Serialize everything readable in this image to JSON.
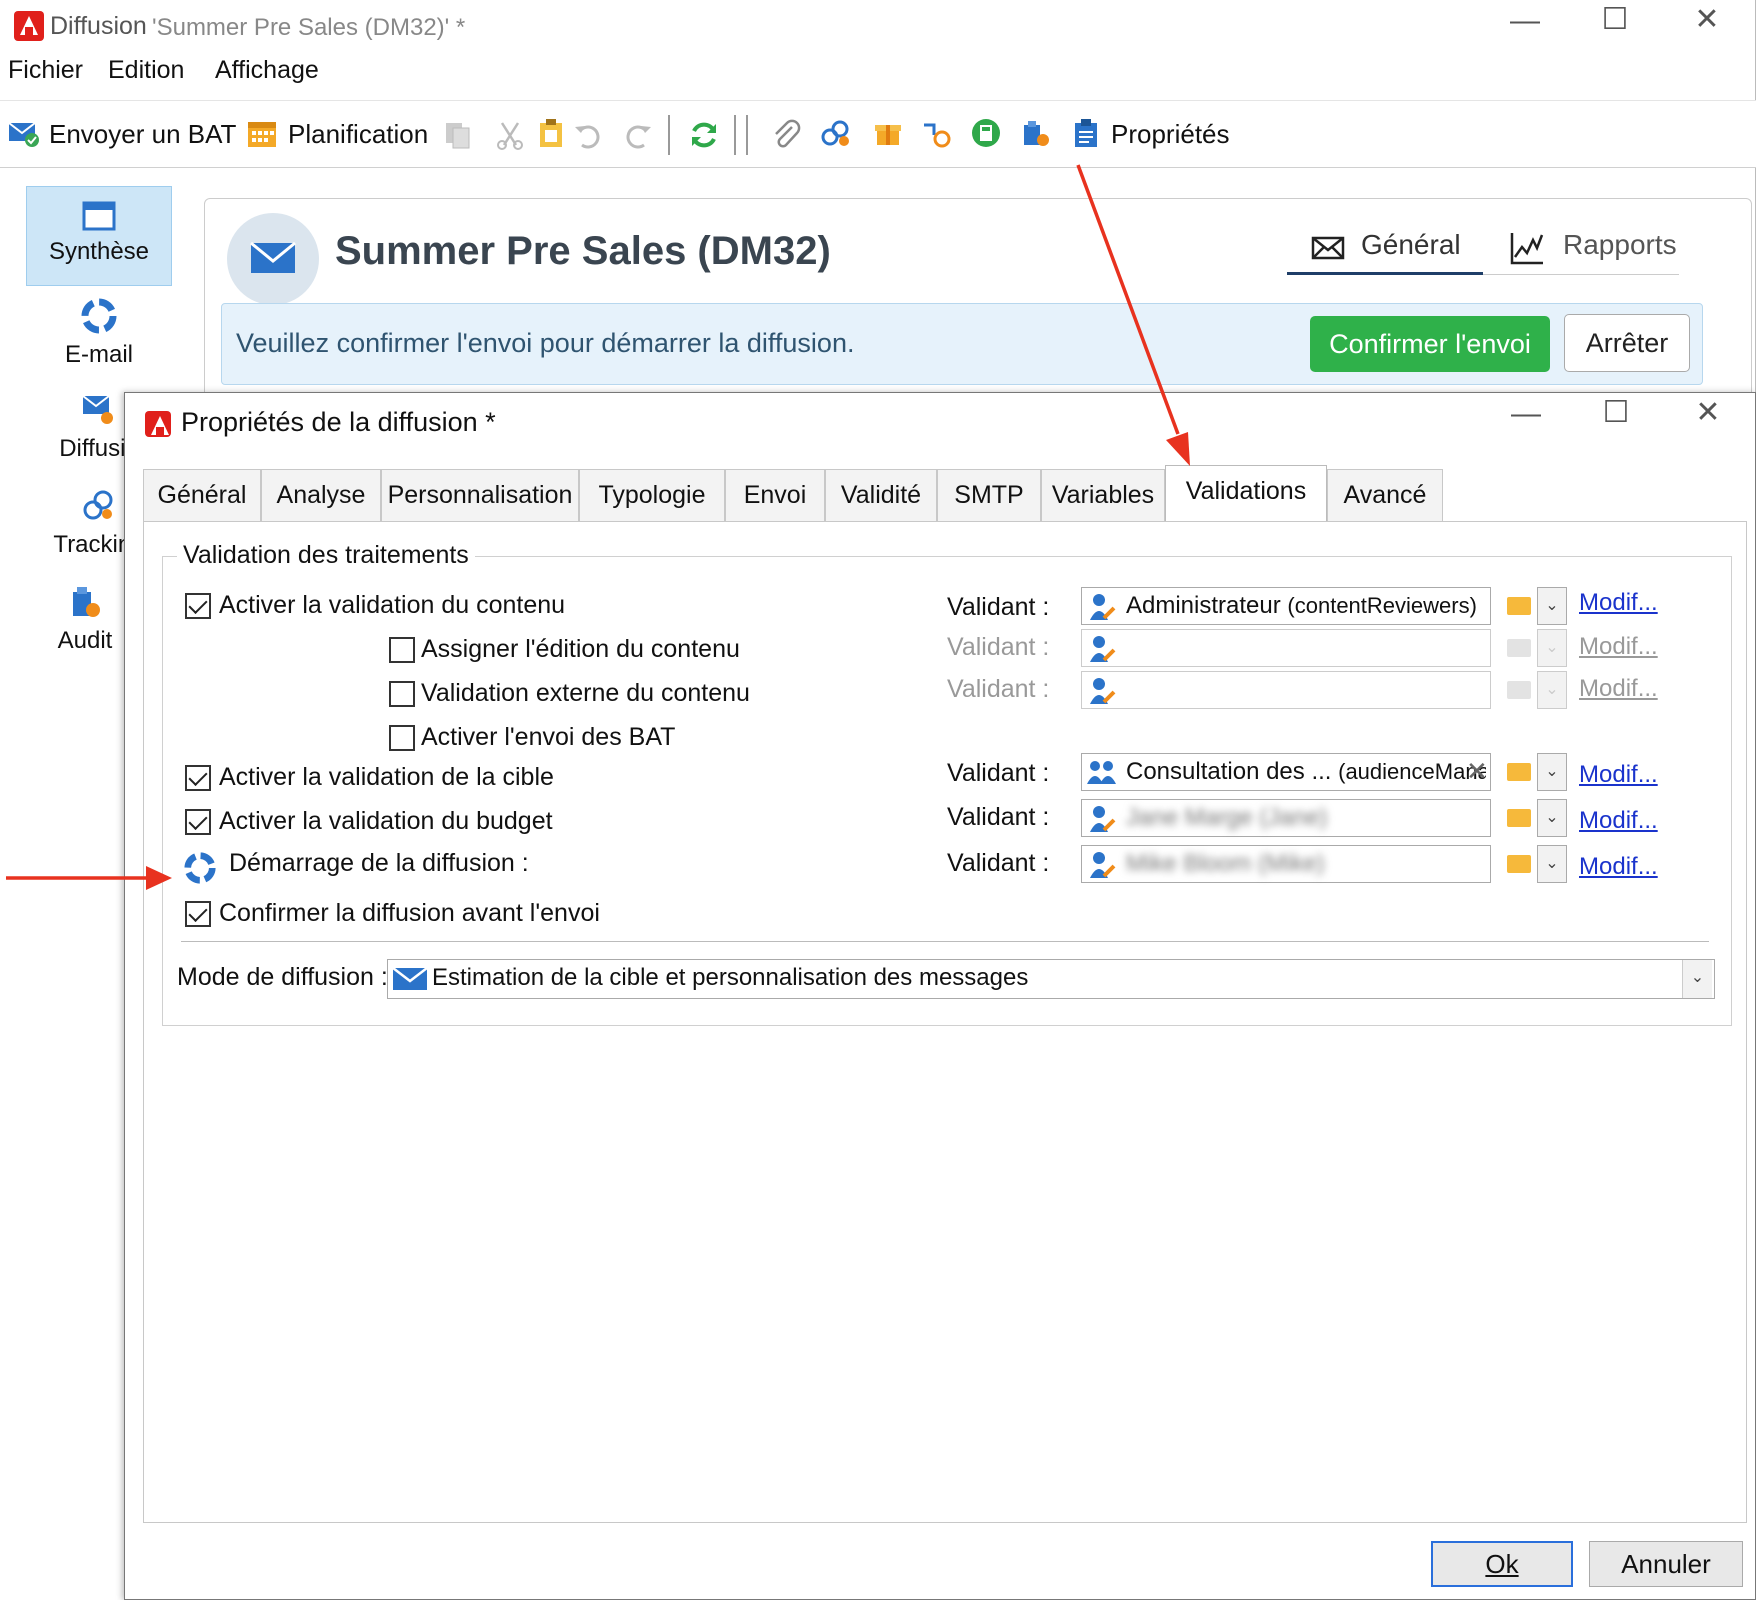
{
  "window": {
    "app_name": "Diffusion",
    "doc_title": "'Summer Pre Sales (DM32)' *"
  },
  "menu": [
    "Fichier",
    "Edition",
    "Affichage"
  ],
  "toolbar": {
    "send_proof": "Envoyer un BAT",
    "schedule": "Planification",
    "properties": "Propriétés"
  },
  "left_nav": [
    {
      "label": "Synthèse",
      "icon": "summary-icon"
    },
    {
      "label": "E-mail",
      "icon": "lifebuoy-icon"
    },
    {
      "label": "Diffusio",
      "icon": "delivery-icon"
    },
    {
      "label": "Tracking",
      "icon": "tracking-icon"
    },
    {
      "label": "Audit",
      "icon": "audit-icon"
    }
  ],
  "summary": {
    "title": "Summer Pre Sales (DM32)",
    "tab_general": "Général",
    "tab_reports": "Rapports",
    "notice": "Veuillez confirmer l'envoi pour démarrer la diffusion.",
    "confirm_button": "Confirmer l'envoi",
    "stop_button": "Arrêter"
  },
  "dialog": {
    "title": "Propriétés de la diffusion *",
    "tabs": [
      "Général",
      "Analyse",
      "Personnalisation",
      "Typologie",
      "Envoi",
      "Validité",
      "SMTP",
      "Variables",
      "Validations",
      "Avancé"
    ],
    "active_tab": "Validations",
    "group_title": "Validation des traitements",
    "validator_label": "Validant :",
    "modify_link": "Modif...",
    "rows": [
      {
        "label": "Activer la validation du contenu",
        "checked": true,
        "validator": "Administrateur",
        "validator_detail": "(contentReviewers)"
      },
      {
        "label": "Assigner l'édition du contenu",
        "checked": false,
        "validator": ""
      },
      {
        "label": "Validation externe du contenu",
        "checked": false,
        "validator": ""
      },
      {
        "label": "Activer l'envoi des BAT",
        "checked": false
      },
      {
        "label": "Activer la validation de la cible",
        "checked": true,
        "validator": "Consultation des ...",
        "validator_detail": "(audienceManag"
      },
      {
        "label": "Activer la validation du budget",
        "checked": true,
        "validator": "Jane Marge (Jane)"
      },
      {
        "label": "Démarrage de la diffusion :",
        "checked": null,
        "validator": "Mike Bloom (Mike)"
      },
      {
        "label": "Confirmer la diffusion avant l'envoi",
        "checked": true
      }
    ],
    "delivery_mode_label": "Mode de diffusion :",
    "delivery_mode_value": "Estimation de la cible et personnalisation des messages",
    "ok_button": "Ok",
    "cancel_button": "Annuler"
  },
  "colors": {
    "accent_green": "#2fb14a",
    "annotation_red": "#e8321f",
    "link_blue": "#1a33cc",
    "notice_bg": "#e6f2fb"
  }
}
